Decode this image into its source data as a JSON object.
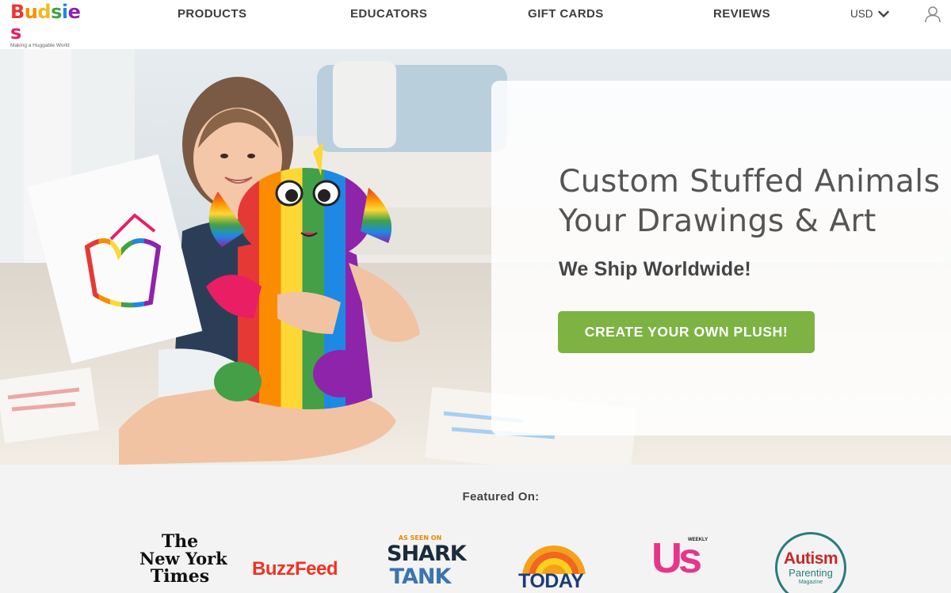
{
  "header": {
    "logo": {
      "letters": [
        "B",
        "u",
        "d",
        "s",
        "i",
        "e",
        "s"
      ],
      "letter_colors": [
        "#e53935",
        "#fb8c00",
        "#fbc02d",
        "#43a047",
        "#1e88e5",
        "#8e24aa",
        "#e91e63"
      ],
      "tagline": "Making a Huggable World"
    },
    "nav": [
      "PRODUCTS",
      "EDUCATORS",
      "GIFT CARDS",
      "REVIEWS"
    ],
    "currency": "USD",
    "icons": {
      "currency_toggle": "chevron-down-icon",
      "account": "user-icon"
    }
  },
  "hero": {
    "title_line1": "Custom Stuffed Animals",
    "title_line2": "Your Drawings & Art",
    "subtitle": "We Ship Worldwide!",
    "cta_label": "CREATE YOUR OWN PLUSH!",
    "accent_color": "#7cb342"
  },
  "featured": {
    "label": "Featured On:",
    "outlets": [
      {
        "name": "The New York Times",
        "lines": [
          "The",
          "New York",
          "Times"
        ]
      },
      {
        "name": "BuzzFeed",
        "text": "BuzzFeed"
      },
      {
        "name": "Shark Tank",
        "top": "AS SEEN ON",
        "line1": "SHARK",
        "line2": "TANK"
      },
      {
        "name": "Today",
        "text": "TODAY"
      },
      {
        "name": "Us Weekly",
        "text": "Us",
        "tag": "WEEKLY"
      },
      {
        "name": "Autism Parenting Magazine",
        "line1": "Autism",
        "line2": "Parenting",
        "line3": "Magazine"
      }
    ]
  }
}
